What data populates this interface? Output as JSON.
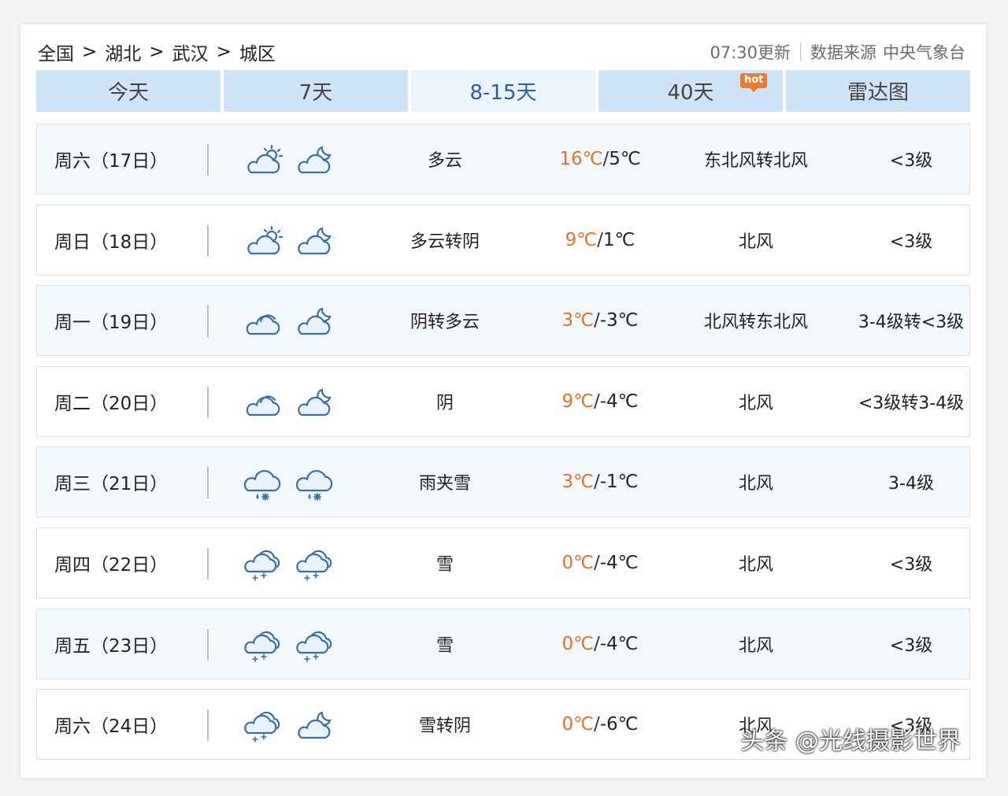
{
  "breadcrumb": [
    "全国",
    "湖北",
    "武汉",
    "城区"
  ],
  "breadcrumb_sep": ">",
  "update_time": "07:30更新",
  "source_label": "数据来源",
  "source_name": "中央气象台",
  "tabs": [
    {
      "label": "今天"
    },
    {
      "label": "7天"
    },
    {
      "label": "8-15天"
    },
    {
      "label": "40天",
      "badge": "hot"
    },
    {
      "label": "雷达图"
    }
  ],
  "active_tab": "8-15天",
  "colors": {
    "accent": "#2c5d9e",
    "tab_bg": "#cfe4f8",
    "temp_high": "#e0722a",
    "badge": "#f07a2c"
  },
  "days": [
    {
      "day": "周六（17日）",
      "icon_day": "partly-cloudy-day-icon",
      "icon_night": "cloudy-night-icon",
      "desc": "多云",
      "high": "16℃",
      "low": "5℃",
      "wind": "东北风转北风",
      "level": "<3级"
    },
    {
      "day": "周日（18日）",
      "icon_day": "partly-cloudy-day-icon",
      "icon_night": "cloudy-night-icon",
      "desc": "多云转阴",
      "high": "9℃",
      "low": "1℃",
      "wind": "北风",
      "level": "<3级"
    },
    {
      "day": "周一（19日）",
      "icon_day": "overcast-icon",
      "icon_night": "cloudy-night-icon",
      "desc": "阴转多云",
      "high": "3℃",
      "low": "-3℃",
      "wind": "北风转东北风",
      "level": "3-4级转<3级"
    },
    {
      "day": "周二（20日）",
      "icon_day": "overcast-icon",
      "icon_night": "cloudy-night-icon",
      "desc": "阴",
      "high": "9℃",
      "low": "-4℃",
      "wind": "北风",
      "level": "<3级转3-4级"
    },
    {
      "day": "周三（21日）",
      "icon_day": "sleet-icon",
      "icon_night": "sleet-icon",
      "desc": "雨夹雪",
      "high": "3℃",
      "low": "-1℃",
      "wind": "北风",
      "level": "3-4级"
    },
    {
      "day": "周四（22日）",
      "icon_day": "snow-icon",
      "icon_night": "snow-icon",
      "desc": "雪",
      "high": "0℃",
      "low": "-4℃",
      "wind": "北风",
      "level": "<3级"
    },
    {
      "day": "周五（23日）",
      "icon_day": "snow-icon",
      "icon_night": "snow-icon",
      "desc": "雪",
      "high": "0℃",
      "low": "-4℃",
      "wind": "北风",
      "level": "<3级"
    },
    {
      "day": "周六（24日）",
      "icon_day": "snow-icon",
      "icon_night": "cloudy-night-icon",
      "desc": "雪转阴",
      "high": "0℃",
      "low": "-6℃",
      "wind": "北风",
      "level": "<3级"
    }
  ],
  "watermark": "头条 @光线摄影世界"
}
